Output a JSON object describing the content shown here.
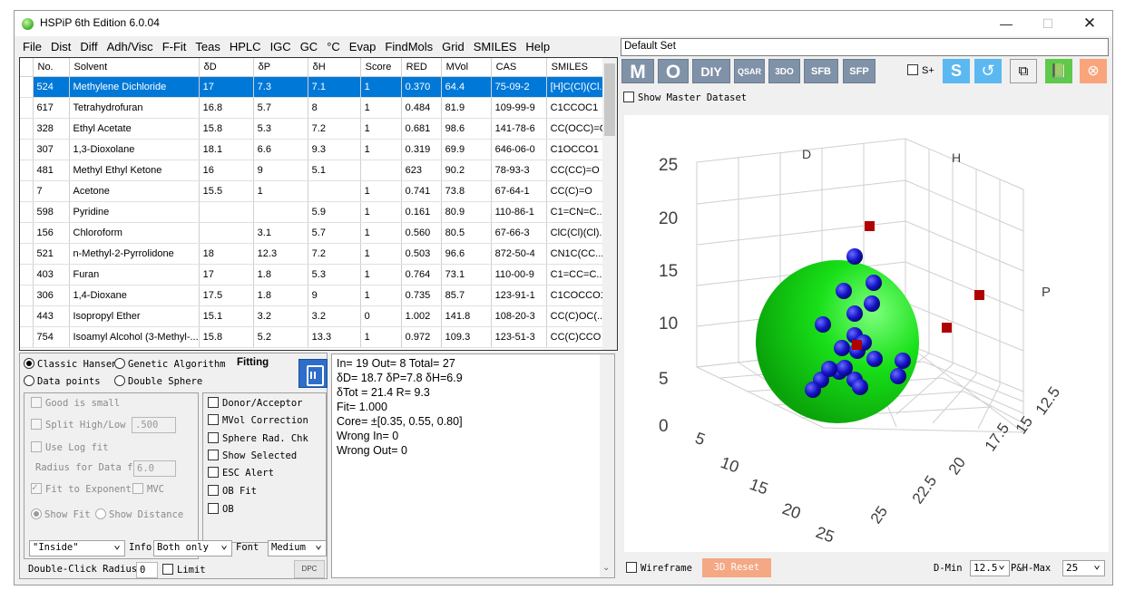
{
  "window": {
    "title": "HSPiP 6th Edition 6.0.04"
  },
  "menu": [
    "File",
    "Dist",
    "Diff",
    "Adh/Visc",
    "F-Fit",
    "Teas",
    "HPLC",
    "IGC",
    "GC",
    "°C",
    "Evap",
    "FindMols",
    "Grid",
    "SMILES",
    "Help"
  ],
  "table": {
    "columns": [
      "No.",
      "Solvent",
      "δD",
      "δP",
      "δH",
      "Score",
      "RED",
      "MVol",
      "CAS",
      "SMILES"
    ],
    "rows": [
      [
        "524",
        "Methylene Dichloride",
        "17",
        "7.3",
        "7.1",
        "1",
        "0.370",
        "64.4",
        "75-09-2",
        "[H]C(Cl)(Cl..."
      ],
      [
        "617",
        "Tetrahydrofuran",
        "16.8",
        "5.7",
        "8",
        "1",
        "0.484",
        "81.9",
        "109-99-9",
        "C1CCOC1"
      ],
      [
        "328",
        "Ethyl Acetate",
        "15.8",
        "5.3",
        "7.2",
        "1",
        "0.681",
        "98.6",
        "141-78-6",
        "CC(OCC)=O"
      ],
      [
        "307",
        "1,3-Dioxolane",
        "18.1",
        "6.6",
        "9.3",
        "1",
        "0.319",
        "69.9",
        "646-06-0",
        "C1OCCO1"
      ],
      [
        "481",
        "Methyl Ethyl Ketone",
        "16",
        "9",
        "5.1",
        "",
        "623",
        "90.2",
        "78-93-3",
        "CC(CC)=O"
      ],
      [
        "7",
        "Acetone",
        "15.5",
        "1",
        "",
        "1",
        "0.741",
        "73.8",
        "67-64-1",
        "CC(C)=O"
      ],
      [
        "598",
        "Pyridine",
        "",
        "",
        "5.9",
        "1",
        "0.161",
        "80.9",
        "110-86-1",
        "C1=CN=C..."
      ],
      [
        "156",
        "Chloroform",
        "",
        "3.1",
        "5.7",
        "1",
        "0.560",
        "80.5",
        "67-66-3",
        "ClC(Cl)(Cl)..."
      ],
      [
        "521",
        "n-Methyl-2-Pyrrolidone",
        "18",
        "12.3",
        "7.2",
        "1",
        "0.503",
        "96.6",
        "872-50-4",
        "CN1C(CC..."
      ],
      [
        "403",
        "Furan",
        "17",
        "1.8",
        "5.3",
        "1",
        "0.764",
        "73.1",
        "110-00-9",
        "C1=CC=C..."
      ],
      [
        "306",
        "1,4-Dioxane",
        "17.5",
        "1.8",
        "9",
        "1",
        "0.735",
        "85.7",
        "123-91-1",
        "C1COCCO1"
      ],
      [
        "443",
        "Isopropyl Ether",
        "15.1",
        "3.2",
        "3.2",
        "0",
        "1.002",
        "141.8",
        "108-20-3",
        "CC(C)OC(..."
      ],
      [
        "754",
        "Isoamyl Alcohol (3-Methyl-...",
        "15.8",
        "5.2",
        "13.3",
        "1",
        "0.972",
        "109.3",
        "123-51-3",
        "CC(C)CCO"
      ]
    ]
  },
  "options": {
    "classic_hansen": "Classic Hansen",
    "genetic_algorithm": "Genetic Algorithm",
    "fitting": "Fitting",
    "data_points": "Data points",
    "double_sphere": "Double Sphere",
    "good_is_small": "Good is small",
    "split_highlow": "Split High/Low @",
    "split_value": ".500",
    "use_log_fit": "Use Log fit",
    "radius_for_data_fit": "Radius for Data fi",
    "radius_value": "6.0",
    "fit_to_exponential": "Fit to Exponenti",
    "mvc": "MVC",
    "show_fit": "Show Fit",
    "show_distance": "Show Distance",
    "donor_acceptor": "Donor/Acceptor",
    "mvol_correction": "MVol Correction",
    "sphere_rad_chk": "Sphere Rad. Chk",
    "show_selected": "Show Selected",
    "esc_alert": "ESC Alert",
    "ob_fit": "OB Fit",
    "ob": "OB",
    "inside_select": "\"Inside\"",
    "info_label": "Info",
    "info_select": "Both only",
    "font_label": "Font",
    "font_select": "Medium",
    "double_click_radius": "Double-Click Radius",
    "double_click_value": "0",
    "limit": "Limit",
    "dpc": "DPC"
  },
  "result": [
    "In= 19 Out= 8 Total= 27",
    "δD= 18.7 δP=7.8 δH=6.9",
    "δTot = 21.4 R= 9.3",
    "Fit= 1.000",
    "Core= ±[0.35, 0.55, 0.80]",
    "Wrong In= 0",
    "Wrong Out= 0"
  ],
  "right": {
    "set_name": "Default Set",
    "toolbar": {
      "m": "M",
      "o": "O",
      "diy": "DIY",
      "qsar": "QSAR",
      "3do": "3DO",
      "sfb": "SFB",
      "sfp": "SFP",
      "splus": "S+",
      "s": "S"
    },
    "show_master": "Show Master Dataset",
    "wireframe": "Wireframe",
    "reset_3d": "3D Reset",
    "dmin_label": "D-Min",
    "dmin_value": "12.5",
    "phmax_label": "P&H-Max",
    "phmax_value": "25"
  },
  "plot3d": {
    "axis_labels": {
      "d": "D",
      "h": "H",
      "p": "P"
    },
    "vertical_ticks": [
      "25",
      "20",
      "15",
      "10",
      "5",
      "0"
    ],
    "front_ticks": [
      "5",
      "10",
      "15",
      "20",
      "25"
    ],
    "depth_ticks": [
      "25",
      "22.5",
      "20",
      "17.5",
      "15",
      "12.5"
    ],
    "colors": {
      "sphere": "#10d010",
      "inside": "#1414c8",
      "outside": "#b00000"
    }
  }
}
